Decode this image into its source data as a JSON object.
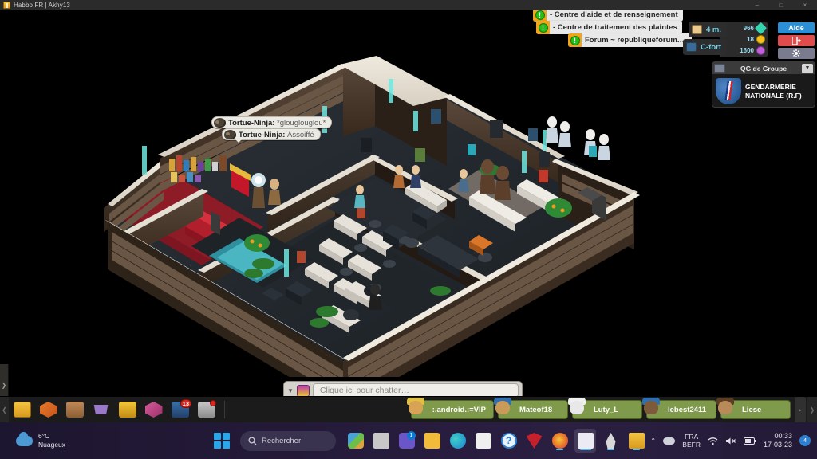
{
  "window": {
    "tab_title": "Habbo FR | Akhy13",
    "favicon": "habbo-icon",
    "controls": {
      "minimize": "–",
      "maximize": "□",
      "close": "×"
    }
  },
  "room": {
    "left_panel_handle": "❯",
    "chat_bubbles": [
      {
        "user": "Tortue-Ninja:",
        "message": "*glouglouglou*"
      },
      {
        "user": "Tortue-Ninja:",
        "message": "Assoiffé"
      }
    ]
  },
  "notifications": [
    {
      "icon": "exclamation-icon",
      "label": "- Centre d'aide et de renseignement"
    },
    {
      "icon": "exclamation-icon",
      "label": "- Centre de traitement des plaintes"
    },
    {
      "icon": "exclamation-icon",
      "label": "Forum ~ republiqueforum.…"
    }
  ],
  "purse": {
    "diamonds": "966",
    "credits": "18",
    "duckets": "1600"
  },
  "room_tools": [
    {
      "icon": "note-icon",
      "label": "4 m."
    },
    {
      "icon": "bed-icon",
      "label": "C-fort"
    }
  ],
  "actions": {
    "help": "Aide",
    "exit_icon": "exit-icon",
    "settings_icon": "gear-icon"
  },
  "group": {
    "header_icon": "group-icon",
    "title": "QG de Groupe",
    "caret": "▼",
    "badge": "gendarmerie-badge",
    "name_line1": "GENDARMERIE",
    "name_line2": "NATIONALE (R.F)"
  },
  "chatbar": {
    "caret": "▼",
    "avatar": "chat-style-icon",
    "placeholder": "Clique ici pour chatter…",
    "value": ""
  },
  "toolbar": {
    "scroll_left": "❮",
    "scroll_right_1": "▸",
    "scroll_right_2": "❯",
    "icons": [
      {
        "name": "habbo-home-icon",
        "class": "g-habbo",
        "badge": ""
      },
      {
        "name": "navigator-icon",
        "class": "g-nav",
        "badge": ""
      },
      {
        "name": "profile-icon",
        "class": "g-profile",
        "badge": ""
      },
      {
        "name": "catalogue-icon",
        "class": "g-cata",
        "badge": ""
      },
      {
        "name": "builders-club-icon",
        "class": "g-build",
        "badge": ""
      },
      {
        "name": "inventory-icon",
        "class": "g-inv",
        "badge": ""
      },
      {
        "name": "friends-icon",
        "class": "g-friend",
        "badge": "13"
      },
      {
        "name": "camera-icon",
        "class": "g-cam",
        "badge": "dot"
      }
    ],
    "users": [
      {
        "name": ":.android.:=VIP",
        "hat": "#e0c040",
        "skin": "#d8a257"
      },
      {
        "name": "Mateof18",
        "hat": "#2f6fb0",
        "skin": "#c99a58"
      },
      {
        "name": "Luty_L",
        "hat": "#f0f0f0",
        "skin": "#e8e8e8"
      },
      {
        "name": "lebest2411",
        "hat": "#2f6fb0",
        "skin": "#7d5b3a"
      },
      {
        "name": "Liese",
        "hat": "#5b3d24",
        "skin": "#b88a58"
      }
    ]
  },
  "taskbar": {
    "weather": {
      "temp": "6°C",
      "condition": "Nuageux",
      "icon": "cloud-icon"
    },
    "start_icon": "windows-start-icon",
    "search_placeholder": "Rechercher",
    "search_icon": "search-icon",
    "apps": [
      {
        "name": "photos-icon",
        "color": "#5aa6d8",
        "badge": "",
        "active": false,
        "running": false
      },
      {
        "name": "task-view-icon",
        "color": "#c8c8c8",
        "badge": "",
        "active": false,
        "running": false
      },
      {
        "name": "teams-icon",
        "color": "#6a56c8",
        "badge": "1",
        "active": false,
        "running": false
      },
      {
        "name": "file-explorer-icon",
        "color": "#f2bb3a",
        "badge": "",
        "active": false,
        "running": false
      },
      {
        "name": "edge-icon",
        "color": "#1a8fd0",
        "badge": "",
        "active": false,
        "running": false
      },
      {
        "name": "microsoft-store-icon",
        "color": "#e8e8e8",
        "badge": "",
        "active": false,
        "running": false
      },
      {
        "name": "help-icon",
        "color": "#2f7fd0",
        "badge": "",
        "active": false,
        "running": false
      },
      {
        "name": "mcafee-icon",
        "color": "#c5202b",
        "badge": "",
        "active": false,
        "running": false
      },
      {
        "name": "firefox-icon",
        "color": "#e8702a",
        "badge": "",
        "active": false,
        "running": true
      },
      {
        "name": "snipping-tool-icon",
        "color": "#e2e2e2",
        "badge": "",
        "active": true,
        "running": true
      },
      {
        "name": "rocket-launcher-icon",
        "color": "#d8d8d8",
        "badge": "",
        "active": false,
        "running": true
      },
      {
        "name": "habbo-client-icon",
        "color": "#f0b81e",
        "badge": "",
        "active": false,
        "running": true
      }
    ],
    "tray": {
      "chevron": "⌃",
      "onedrive_icon": "cloud-icon",
      "lang_line1": "FRA",
      "lang_line2": "BEFR",
      "wifi_icon": "wifi-icon",
      "volume_icon": "volume-muted-icon",
      "battery_icon": "battery-icon",
      "time": "00:33",
      "date": "17-03-23",
      "notification_count": "4"
    }
  }
}
